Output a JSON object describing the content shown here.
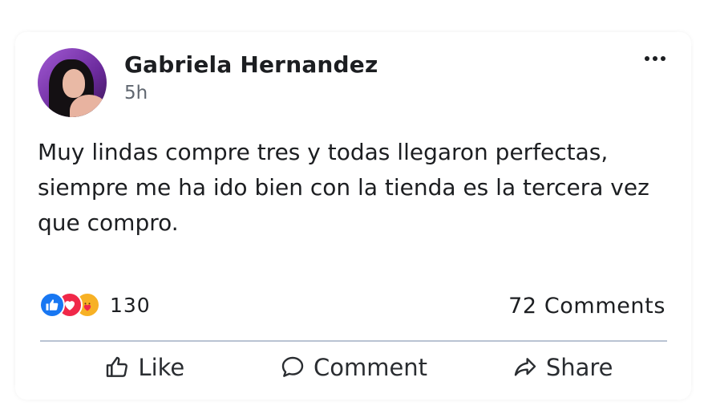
{
  "post": {
    "author": "Gabriela Hernandez",
    "time": "5h",
    "text": "Muy lindas compre tres y todas llegaron perfectas, siempre me ha ido bien con la tienda es la tercera vez que compro.",
    "reactions": {
      "icons": [
        "like-icon",
        "love-icon",
        "care-icon"
      ],
      "count": "130"
    },
    "comments_label": "72 Comments",
    "actions": {
      "like": "Like",
      "comment": "Comment",
      "share": "Share"
    }
  },
  "colors": {
    "like": "#1877f2",
    "love": "#f02849",
    "care": "#f7b125",
    "text": "#1c1e21",
    "divider": "#b9c3d3"
  }
}
